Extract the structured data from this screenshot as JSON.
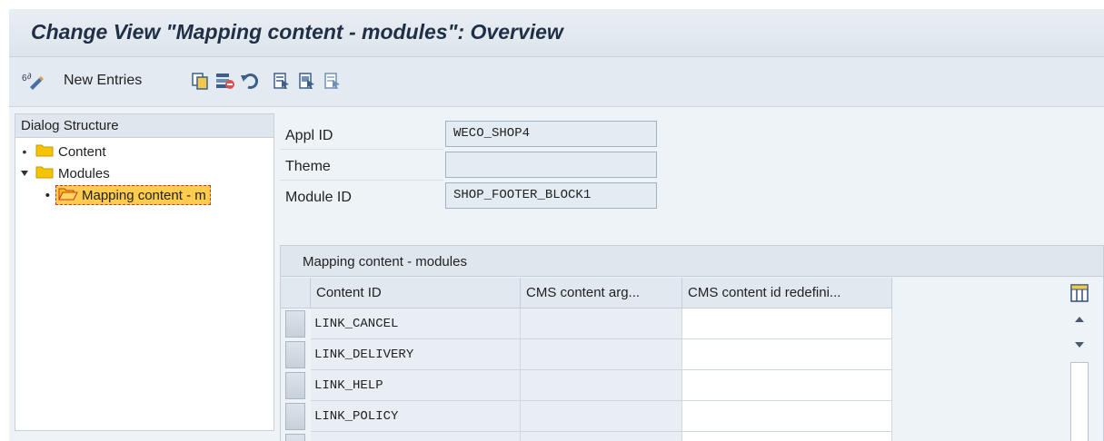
{
  "title": "Change View \"Mapping content - modules\": Overview",
  "toolbar": {
    "new_entries": "New Entries"
  },
  "dialog_structure": {
    "header": "Dialog Structure",
    "items": [
      {
        "label": "Content",
        "expanded": false,
        "level": 0
      },
      {
        "label": "Modules",
        "expanded": true,
        "level": 0
      },
      {
        "label": "Mapping content - m",
        "selected": true,
        "level": 1
      }
    ]
  },
  "fields": [
    {
      "label": "Appl ID",
      "value": "WECO_SHOP4"
    },
    {
      "label": "Theme",
      "value": ""
    },
    {
      "label": "Module ID",
      "value": "SHOP_FOOTER_BLOCK1"
    }
  ],
  "table": {
    "title": "Mapping content - modules",
    "columns": [
      "Content ID",
      "CMS content arg...",
      "CMS content id redefini..."
    ],
    "rows": [
      [
        "LINK_CANCEL",
        "",
        ""
      ],
      [
        "LINK_DELIVERY",
        "",
        ""
      ],
      [
        "LINK_HELP",
        "",
        ""
      ],
      [
        "LINK_POLICY",
        "",
        ""
      ]
    ]
  },
  "colors": {
    "title_text": "#1f2f46",
    "folder": "#f5c400",
    "selection": "#ffcc4d"
  }
}
